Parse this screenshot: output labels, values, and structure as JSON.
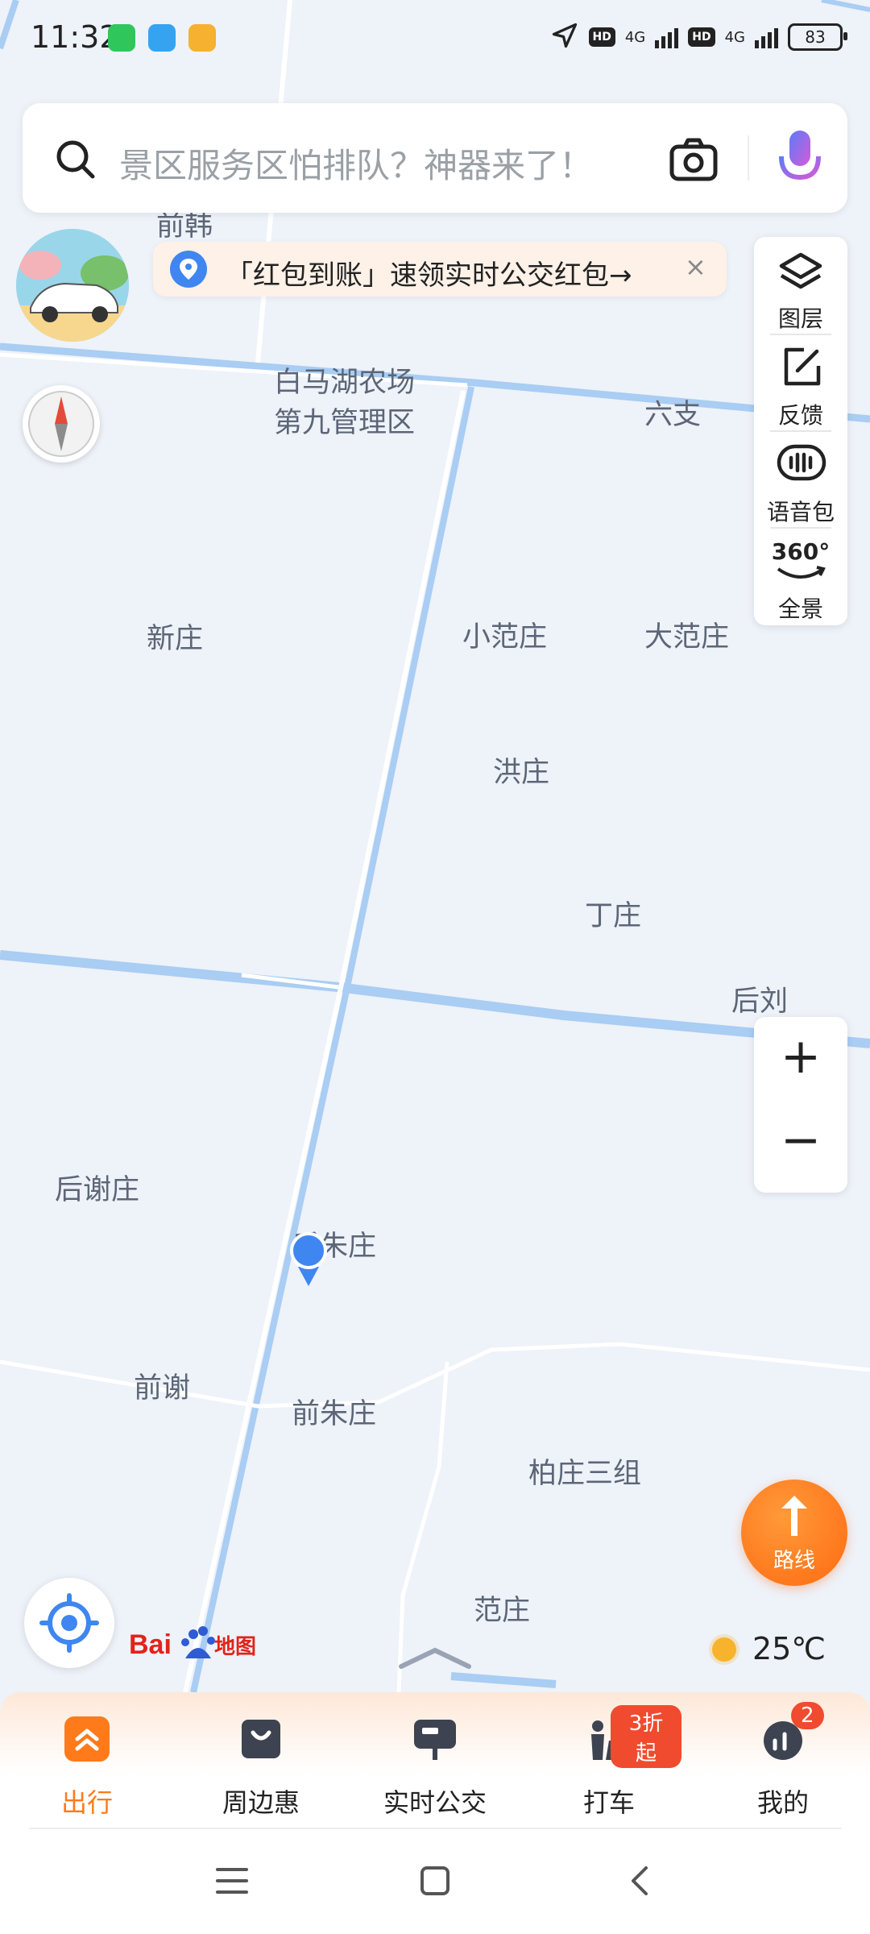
{
  "status_bar": {
    "time": "11:32",
    "network_label": "4G",
    "hd_label": "HD",
    "battery": "83"
  },
  "search": {
    "placeholder": "景区服务区怕排队？神器来了！"
  },
  "promo": {
    "text": "「红包到账」速领实时公交红包→",
    "close": "×"
  },
  "right_panel": {
    "layers": "图层",
    "feedback": "反馈",
    "voice_pack": "语音包",
    "panorama": "全景",
    "panorama_icon_text": "360°"
  },
  "zoom": {
    "in": "+",
    "out": "−"
  },
  "map_labels": {
    "qianhan": "前韩",
    "farm_line1": "白马湖农场",
    "farm_line2": "第九管理区",
    "liuzhi": "六支",
    "xinzhuang": "新庄",
    "xiaofanzhuang": "小范庄",
    "dafanzhuang": "大范庄",
    "hongzhuang": "洪庄",
    "dingzhuang": "丁庄",
    "houliu": "后刘",
    "houxiezhuang": "后谢庄",
    "houzhuzhuang": "后朱庄",
    "qianxie": "前谢",
    "qianzhuzhuang": "前朱庄",
    "baizhuangsanzu": "柏庄三组",
    "fanzhuang": "范庄"
  },
  "route_button": {
    "label": "路线"
  },
  "logo": {
    "text": "Bai du 地图"
  },
  "weather": {
    "temperature": "25℃"
  },
  "tabs": [
    {
      "label": "出行",
      "active": true
    },
    {
      "label": "周边惠",
      "active": false
    },
    {
      "label": "实时公交",
      "active": false
    },
    {
      "label": "打车",
      "active": false,
      "badge": "3折起"
    },
    {
      "label": "我的",
      "active": false,
      "badge": "2"
    }
  ],
  "colors": {
    "accent_orange": "#ff7a1a",
    "map_bg": "#eef2f9",
    "water": "#a9cdf3",
    "location_blue": "#3f86f0"
  }
}
